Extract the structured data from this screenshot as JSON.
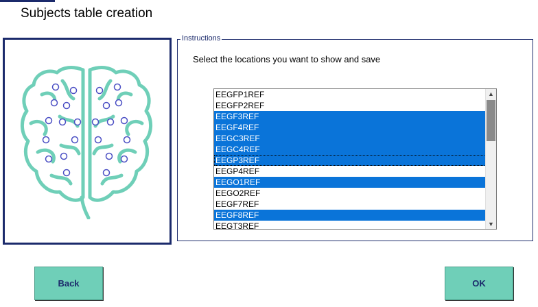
{
  "title": "Subjects table creation",
  "group_legend": "Instructions",
  "instruction": "Select the locations you want to show and save",
  "locations": [
    {
      "label": "EEGFP1REF",
      "selected": false
    },
    {
      "label": "EEGFP2REF",
      "selected": false
    },
    {
      "label": "EEGF3REF",
      "selected": true
    },
    {
      "label": "EEGF4REF",
      "selected": true
    },
    {
      "label": "EEGC3REF",
      "selected": true
    },
    {
      "label": "EEGC4REF",
      "selected": true
    },
    {
      "label": "EEGP3REF",
      "selected": true,
      "focused": true
    },
    {
      "label": "EEGP4REF",
      "selected": false
    },
    {
      "label": "EEGO1REF",
      "selected": true
    },
    {
      "label": "EEGO2REF",
      "selected": false
    },
    {
      "label": "EEGF7REF",
      "selected": false
    },
    {
      "label": "EEGF8REF",
      "selected": true
    },
    {
      "label": "EEGT3REF",
      "selected": false
    }
  ],
  "buttons": {
    "back": "Back",
    "ok": "OK"
  },
  "colors": {
    "accent": "#1b2a6b",
    "button": "#6fcfb8",
    "selection": "#0a74d9",
    "brain": "#6fcfb8"
  }
}
